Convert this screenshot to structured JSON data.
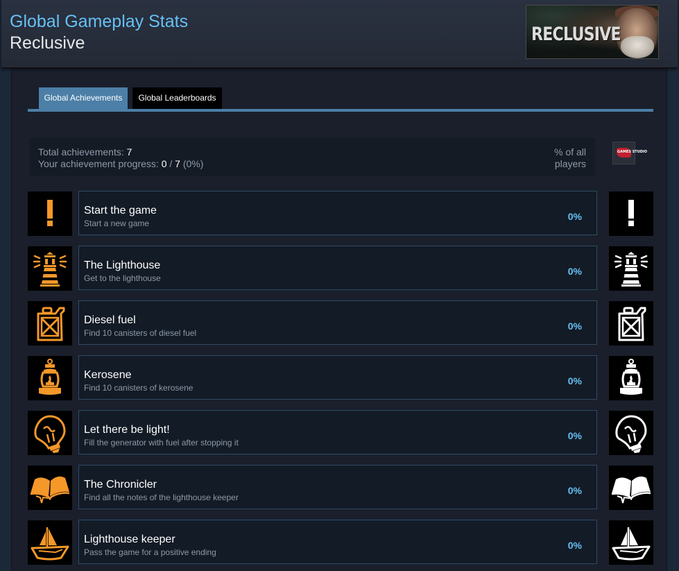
{
  "header": {
    "title": "Global Gameplay Stats",
    "game_name": "Reclusive",
    "banner_logo": "RECLUSIVE"
  },
  "tabs": [
    {
      "label": "Global Achievements",
      "active": true
    },
    {
      "label": "Global Leaderboards",
      "active": false
    }
  ],
  "summary": {
    "total_label": "Total achievements:",
    "total_value": "7",
    "progress_label": "Your achievement progress:",
    "progress_unlocked": "0",
    "progress_sep": "/",
    "progress_total": "7",
    "progress_percent": "(0%)",
    "pct_header": "% of all players",
    "dev_logo_text": "GAMES STUDIO"
  },
  "colors": {
    "achieved_icon": "#f5982a",
    "unachieved_icon": "#ffffff",
    "accent": "#66c0f4",
    "tab_active": "#4c7fa7"
  },
  "achievements": [
    {
      "name": "Start the game",
      "description": "Start a new game",
      "percent": "0%",
      "icon": "exclamation-icon"
    },
    {
      "name": "The Lighthouse",
      "description": "Get to the lighthouse",
      "percent": "0%",
      "icon": "lighthouse-icon"
    },
    {
      "name": "Diesel fuel",
      "description": "Find 10 canisters of diesel fuel",
      "percent": "0%",
      "icon": "jerrycan-icon"
    },
    {
      "name": "Kerosene",
      "description": "Find 10 canisters of kerosene",
      "percent": "0%",
      "icon": "lantern-icon"
    },
    {
      "name": "Let there be light!",
      "description": "Fill the generator with fuel after stopping it",
      "percent": "0%",
      "icon": "lightbulb-icon"
    },
    {
      "name": "The Chronicler",
      "description": "Find all the notes of the lighthouse keeper",
      "percent": "0%",
      "icon": "open-book-icon"
    },
    {
      "name": "Lighthouse keeper",
      "description": "Pass the game for a positive ending",
      "percent": "0%",
      "icon": "paper-boat-icon"
    }
  ]
}
